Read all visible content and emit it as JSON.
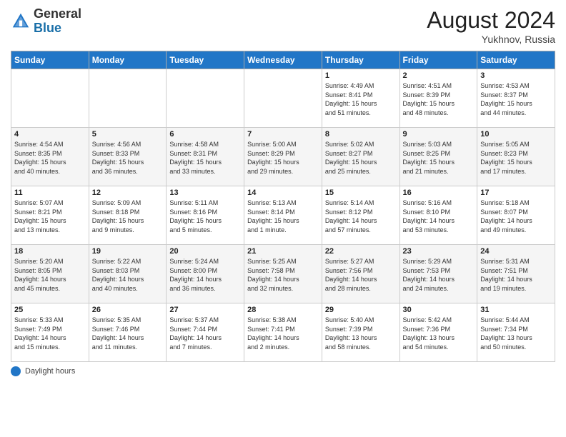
{
  "header": {
    "logo_general": "General",
    "logo_blue": "Blue",
    "month_year": "August 2024",
    "location": "Yukhnov, Russia"
  },
  "days_header": [
    "Sunday",
    "Monday",
    "Tuesday",
    "Wednesday",
    "Thursday",
    "Friday",
    "Saturday"
  ],
  "footer": {
    "label": "Daylight hours"
  },
  "weeks": [
    {
      "days": [
        {
          "num": "",
          "info": ""
        },
        {
          "num": "",
          "info": ""
        },
        {
          "num": "",
          "info": ""
        },
        {
          "num": "",
          "info": ""
        },
        {
          "num": "1",
          "info": "Sunrise: 4:49 AM\nSunset: 8:41 PM\nDaylight: 15 hours\nand 51 minutes."
        },
        {
          "num": "2",
          "info": "Sunrise: 4:51 AM\nSunset: 8:39 PM\nDaylight: 15 hours\nand 48 minutes."
        },
        {
          "num": "3",
          "info": "Sunrise: 4:53 AM\nSunset: 8:37 PM\nDaylight: 15 hours\nand 44 minutes."
        }
      ]
    },
    {
      "days": [
        {
          "num": "4",
          "info": "Sunrise: 4:54 AM\nSunset: 8:35 PM\nDaylight: 15 hours\nand 40 minutes."
        },
        {
          "num": "5",
          "info": "Sunrise: 4:56 AM\nSunset: 8:33 PM\nDaylight: 15 hours\nand 36 minutes."
        },
        {
          "num": "6",
          "info": "Sunrise: 4:58 AM\nSunset: 8:31 PM\nDaylight: 15 hours\nand 33 minutes."
        },
        {
          "num": "7",
          "info": "Sunrise: 5:00 AM\nSunset: 8:29 PM\nDaylight: 15 hours\nand 29 minutes."
        },
        {
          "num": "8",
          "info": "Sunrise: 5:02 AM\nSunset: 8:27 PM\nDaylight: 15 hours\nand 25 minutes."
        },
        {
          "num": "9",
          "info": "Sunrise: 5:03 AM\nSunset: 8:25 PM\nDaylight: 15 hours\nand 21 minutes."
        },
        {
          "num": "10",
          "info": "Sunrise: 5:05 AM\nSunset: 8:23 PM\nDaylight: 15 hours\nand 17 minutes."
        }
      ]
    },
    {
      "days": [
        {
          "num": "11",
          "info": "Sunrise: 5:07 AM\nSunset: 8:21 PM\nDaylight: 15 hours\nand 13 minutes."
        },
        {
          "num": "12",
          "info": "Sunrise: 5:09 AM\nSunset: 8:18 PM\nDaylight: 15 hours\nand 9 minutes."
        },
        {
          "num": "13",
          "info": "Sunrise: 5:11 AM\nSunset: 8:16 PM\nDaylight: 15 hours\nand 5 minutes."
        },
        {
          "num": "14",
          "info": "Sunrise: 5:13 AM\nSunset: 8:14 PM\nDaylight: 15 hours\nand 1 minute."
        },
        {
          "num": "15",
          "info": "Sunrise: 5:14 AM\nSunset: 8:12 PM\nDaylight: 14 hours\nand 57 minutes."
        },
        {
          "num": "16",
          "info": "Sunrise: 5:16 AM\nSunset: 8:10 PM\nDaylight: 14 hours\nand 53 minutes."
        },
        {
          "num": "17",
          "info": "Sunrise: 5:18 AM\nSunset: 8:07 PM\nDaylight: 14 hours\nand 49 minutes."
        }
      ]
    },
    {
      "days": [
        {
          "num": "18",
          "info": "Sunrise: 5:20 AM\nSunset: 8:05 PM\nDaylight: 14 hours\nand 45 minutes."
        },
        {
          "num": "19",
          "info": "Sunrise: 5:22 AM\nSunset: 8:03 PM\nDaylight: 14 hours\nand 40 minutes."
        },
        {
          "num": "20",
          "info": "Sunrise: 5:24 AM\nSunset: 8:00 PM\nDaylight: 14 hours\nand 36 minutes."
        },
        {
          "num": "21",
          "info": "Sunrise: 5:25 AM\nSunset: 7:58 PM\nDaylight: 14 hours\nand 32 minutes."
        },
        {
          "num": "22",
          "info": "Sunrise: 5:27 AM\nSunset: 7:56 PM\nDaylight: 14 hours\nand 28 minutes."
        },
        {
          "num": "23",
          "info": "Sunrise: 5:29 AM\nSunset: 7:53 PM\nDaylight: 14 hours\nand 24 minutes."
        },
        {
          "num": "24",
          "info": "Sunrise: 5:31 AM\nSunset: 7:51 PM\nDaylight: 14 hours\nand 19 minutes."
        }
      ]
    },
    {
      "days": [
        {
          "num": "25",
          "info": "Sunrise: 5:33 AM\nSunset: 7:49 PM\nDaylight: 14 hours\nand 15 minutes."
        },
        {
          "num": "26",
          "info": "Sunrise: 5:35 AM\nSunset: 7:46 PM\nDaylight: 14 hours\nand 11 minutes."
        },
        {
          "num": "27",
          "info": "Sunrise: 5:37 AM\nSunset: 7:44 PM\nDaylight: 14 hours\nand 7 minutes."
        },
        {
          "num": "28",
          "info": "Sunrise: 5:38 AM\nSunset: 7:41 PM\nDaylight: 14 hours\nand 2 minutes."
        },
        {
          "num": "29",
          "info": "Sunrise: 5:40 AM\nSunset: 7:39 PM\nDaylight: 13 hours\nand 58 minutes."
        },
        {
          "num": "30",
          "info": "Sunrise: 5:42 AM\nSunset: 7:36 PM\nDaylight: 13 hours\nand 54 minutes."
        },
        {
          "num": "31",
          "info": "Sunrise: 5:44 AM\nSunset: 7:34 PM\nDaylight: 13 hours\nand 50 minutes."
        }
      ]
    }
  ]
}
